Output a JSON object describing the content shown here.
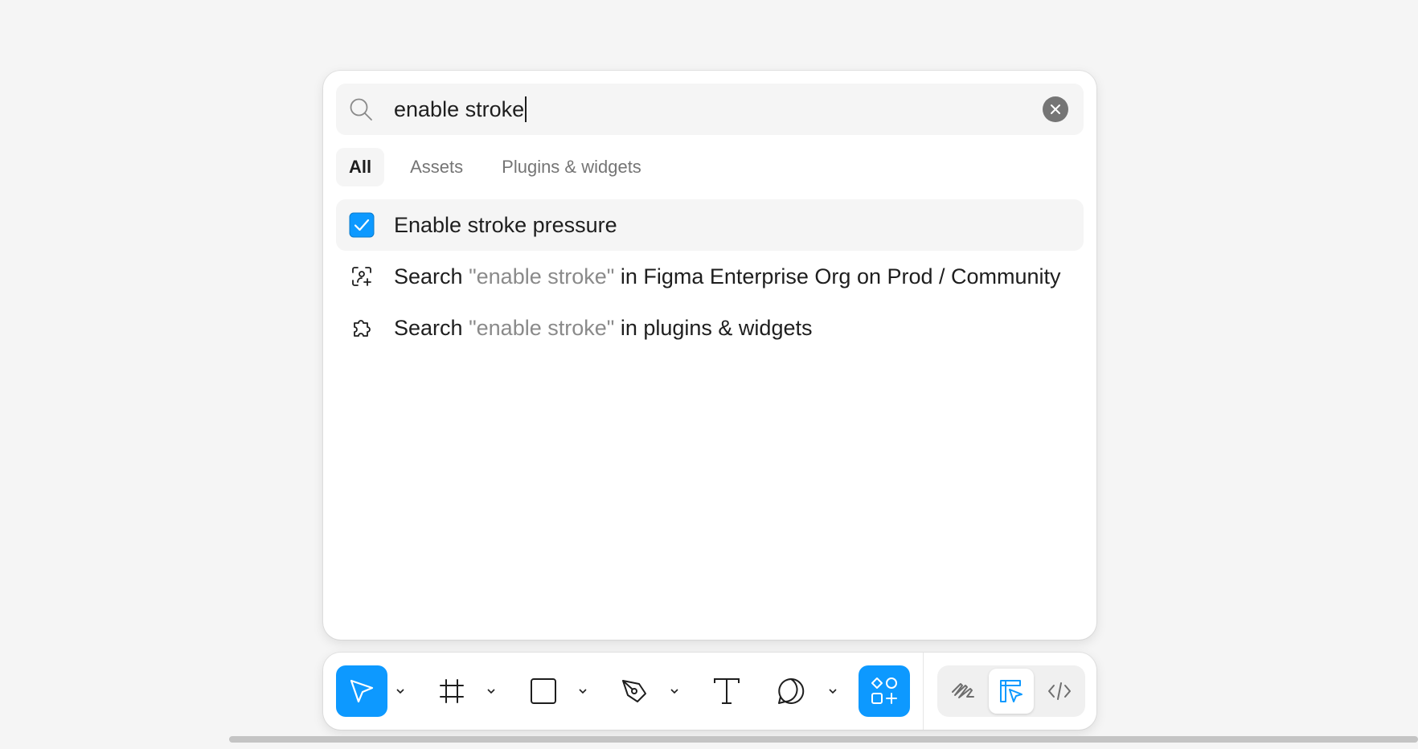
{
  "search": {
    "query": "enable stroke",
    "clear_icon": "close-circle-icon",
    "search_icon": "magnifier-icon"
  },
  "tabs": [
    {
      "label": "All",
      "active": true
    },
    {
      "label": "Assets",
      "active": false
    },
    {
      "label": "Plugins & widgets",
      "active": false
    }
  ],
  "results": [
    {
      "icon": "checkbox-checked-icon",
      "label": "Enable stroke pressure"
    },
    {
      "icon": "community-search-icon",
      "prefix": "Search ",
      "query": "\"enable stroke\"",
      "suffix": " in Figma Enterprise Org on Prod / Community"
    },
    {
      "icon": "plugin-puzzle-icon",
      "prefix": "Search ",
      "query": "\"enable stroke\"",
      "suffix": " in plugins & widgets"
    }
  ],
  "toolbar": {
    "tools": [
      "move-tool",
      "frame-tool",
      "rectangle-tool",
      "pen-tool",
      "text-tool",
      "comment-tool",
      "actions-tool"
    ],
    "active_tool": "move-tool",
    "modes": [
      "draw-mode",
      "design-mode",
      "dev-mode"
    ],
    "active_mode": "design-mode"
  },
  "colors": {
    "accent": "#0d99ff",
    "muted_text": "#8a8a8a",
    "background": "#f5f5f5"
  }
}
